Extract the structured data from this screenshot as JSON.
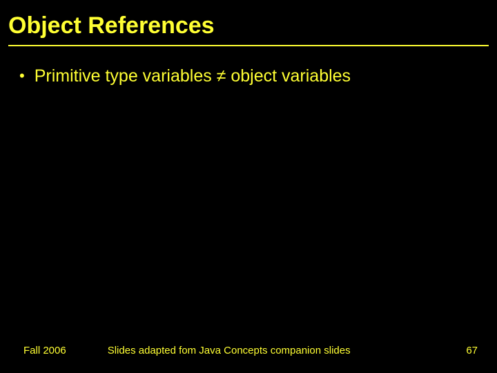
{
  "slide": {
    "title": "Object References",
    "bullets": [
      "Primitive type variables ≠ object variables"
    ],
    "footer": {
      "left": "Fall 2006",
      "center": "Slides adapted fom Java Concepts companion slides",
      "right": "67"
    }
  }
}
